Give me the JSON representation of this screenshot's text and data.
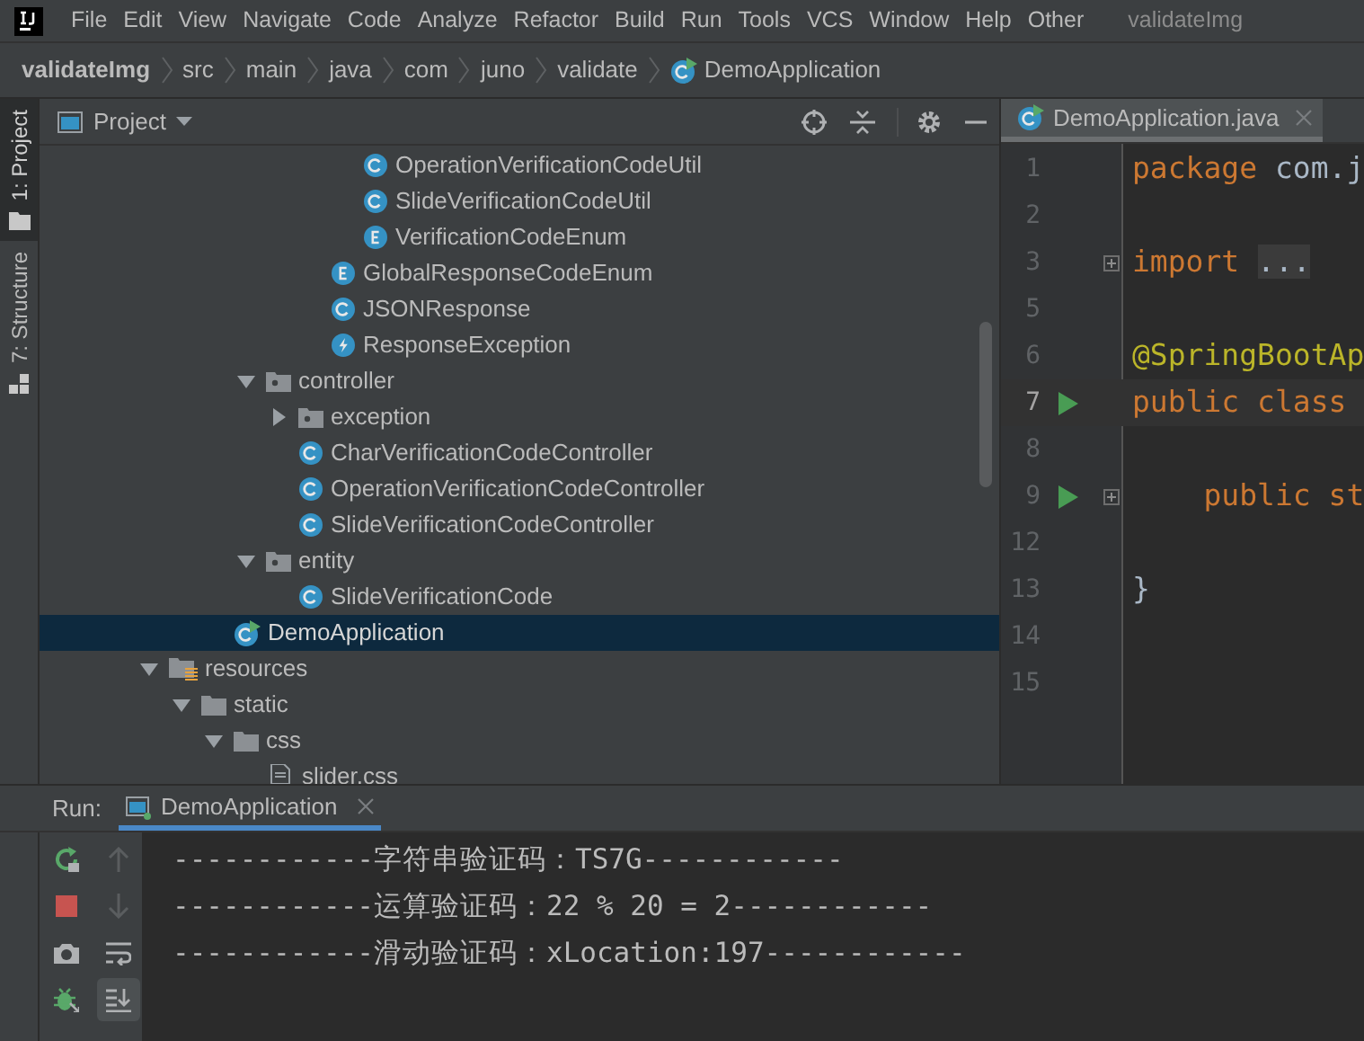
{
  "menu_bar": {
    "items": [
      "File",
      "Edit",
      "View",
      "Navigate",
      "Code",
      "Analyze",
      "Refactor",
      "Build",
      "Run",
      "Tools",
      "VCS",
      "Window",
      "Help",
      "Other"
    ],
    "window_title": "validateImg"
  },
  "breadcrumb": [
    {
      "label": "validateImg",
      "kind": "project"
    },
    {
      "label": "src",
      "kind": "dir"
    },
    {
      "label": "main",
      "kind": "dir"
    },
    {
      "label": "java",
      "kind": "dir"
    },
    {
      "label": "com",
      "kind": "dir"
    },
    {
      "label": "juno",
      "kind": "dir"
    },
    {
      "label": "validate",
      "kind": "dir"
    },
    {
      "label": "DemoApplication",
      "kind": "app-class"
    }
  ],
  "side_tabs": [
    {
      "label": "1: Project",
      "selected": true,
      "kind": "folder"
    },
    {
      "label": "7: Structure",
      "selected": false,
      "kind": "structure"
    }
  ],
  "project_panel": {
    "title": "Project",
    "tree": [
      {
        "children": [
          {
            "children": [
              {
                "children": [
                  {
                    "children": [
                      {
                        "children": [
                          {
                            "children": [
                              {
                                "label": "OperationVerificationCodeUtil",
                                "kind": "class",
                                "selected": false
                              },
                              {
                                "label": "SlideVerificationCodeUtil",
                                "kind": "class",
                                "selected": false
                              },
                              {
                                "label": "VerificationCodeEnum",
                                "kind": "enum",
                                "selected": false
                              }
                            ]
                          },
                          {
                            "label": "GlobalResponseCodeEnum",
                            "kind": "enum",
                            "selected": false
                          },
                          {
                            "label": "JSONResponse",
                            "kind": "class",
                            "selected": false
                          },
                          {
                            "label": "ResponseException",
                            "kind": "exception",
                            "selected": false
                          }
                        ]
                      }
                    ]
                  },
                  {
                    "label": "controller",
                    "kind": "package",
                    "selected": false,
                    "expanded": true,
                    "children": [
                      {
                        "label": "exception",
                        "kind": "package",
                        "selected": false,
                        "expanded": false
                      },
                      {
                        "label": "CharVerificationCodeController",
                        "kind": "class",
                        "selected": false
                      },
                      {
                        "label": "OperationVerificationCodeController",
                        "kind": "class",
                        "selected": false
                      },
                      {
                        "label": "SlideVerificationCodeController",
                        "kind": "class",
                        "selected": false
                      }
                    ]
                  },
                  {
                    "label": "entity",
                    "kind": "package",
                    "selected": false,
                    "expanded": true,
                    "children": [
                      {
                        "label": "SlideVerificationCode",
                        "kind": "class",
                        "selected": false
                      }
                    ]
                  }
                ]
              },
              {
                "label": "DemoApplication",
                "kind": "app-class",
                "selected": true
              }
            ]
          }
        ]
      },
      {
        "label": "resources",
        "kind": "resources-folder",
        "selected": false,
        "expanded": true,
        "children": [
          {
            "label": "static",
            "kind": "folder",
            "selected": false,
            "expanded": true,
            "children": [
              {
                "label": "css",
                "kind": "folder",
                "selected": false,
                "expanded": true,
                "children": [
                  {
                    "label": "slider.css",
                    "kind": "css",
                    "selected": false
                  }
                ]
              }
            ]
          }
        ]
      }
    ]
  },
  "editor_tabs": [
    {
      "label": "DemoApplication.java",
      "selected": true
    }
  ],
  "editor": {
    "lines": [
      {
        "number": "1",
        "current": false,
        "run_marker": false,
        "fold_marker": false,
        "tokens": [
          {
            "kind": "keyword",
            "text": "package"
          },
          {
            "kind": "plain",
            "text": " com.j"
          }
        ]
      },
      {
        "number": "2",
        "current": false,
        "run_marker": false,
        "fold_marker": false
      },
      {
        "number": "3",
        "current": false,
        "run_marker": false,
        "fold_marker": true,
        "tokens": [
          {
            "kind": "keyword",
            "text": "import "
          },
          {
            "kind": "folded",
            "text": "..."
          }
        ]
      },
      {
        "number": "5",
        "current": false,
        "run_marker": false,
        "fold_marker": false
      },
      {
        "number": "6",
        "current": false,
        "run_marker": false,
        "fold_marker": false,
        "tokens": [
          {
            "kind": "annotation",
            "text": "@SpringBootAp"
          }
        ]
      },
      {
        "number": "7",
        "current": true,
        "run_marker": true,
        "fold_marker": false,
        "tokens": [
          {
            "kind": "keyword",
            "text": "public class"
          }
        ]
      },
      {
        "number": "8",
        "current": false,
        "run_marker": false,
        "fold_marker": false
      },
      {
        "number": "9",
        "current": false,
        "run_marker": true,
        "fold_marker": true,
        "tokens": [
          {
            "kind": "keyword",
            "text": "    public st"
          }
        ]
      },
      {
        "number": "12",
        "current": false,
        "run_marker": false,
        "fold_marker": false
      },
      {
        "number": "13",
        "current": false,
        "run_marker": false,
        "fold_marker": false,
        "tokens": [
          {
            "kind": "plain",
            "text": "}"
          }
        ]
      },
      {
        "number": "14",
        "current": false,
        "run_marker": false,
        "fold_marker": false
      },
      {
        "number": "15",
        "current": false,
        "run_marker": false,
        "fold_marker": false
      }
    ]
  },
  "run_panel": {
    "label": "Run:",
    "tabs": [
      {
        "label": "DemoApplication",
        "selected": true
      }
    ],
    "toolbar_1": [
      {
        "kind": "rerun"
      },
      {
        "kind": "stop"
      },
      {
        "kind": "camera"
      },
      {
        "kind": "debug"
      }
    ],
    "toolbar_2": [
      {
        "kind": "up",
        "disabled": true,
        "on": false
      },
      {
        "kind": "down",
        "disabled": true,
        "on": false
      },
      {
        "kind": "wrap",
        "disabled": false,
        "on": false
      },
      {
        "kind": "scroll-end",
        "disabled": false,
        "on": true
      }
    ],
    "console": [
      "------------字符串验证码：TS7G------------",
      "------------运算验证码：22 % 20 = 2------------",
      "------------滑动验证码：xLocation:197------------"
    ]
  }
}
